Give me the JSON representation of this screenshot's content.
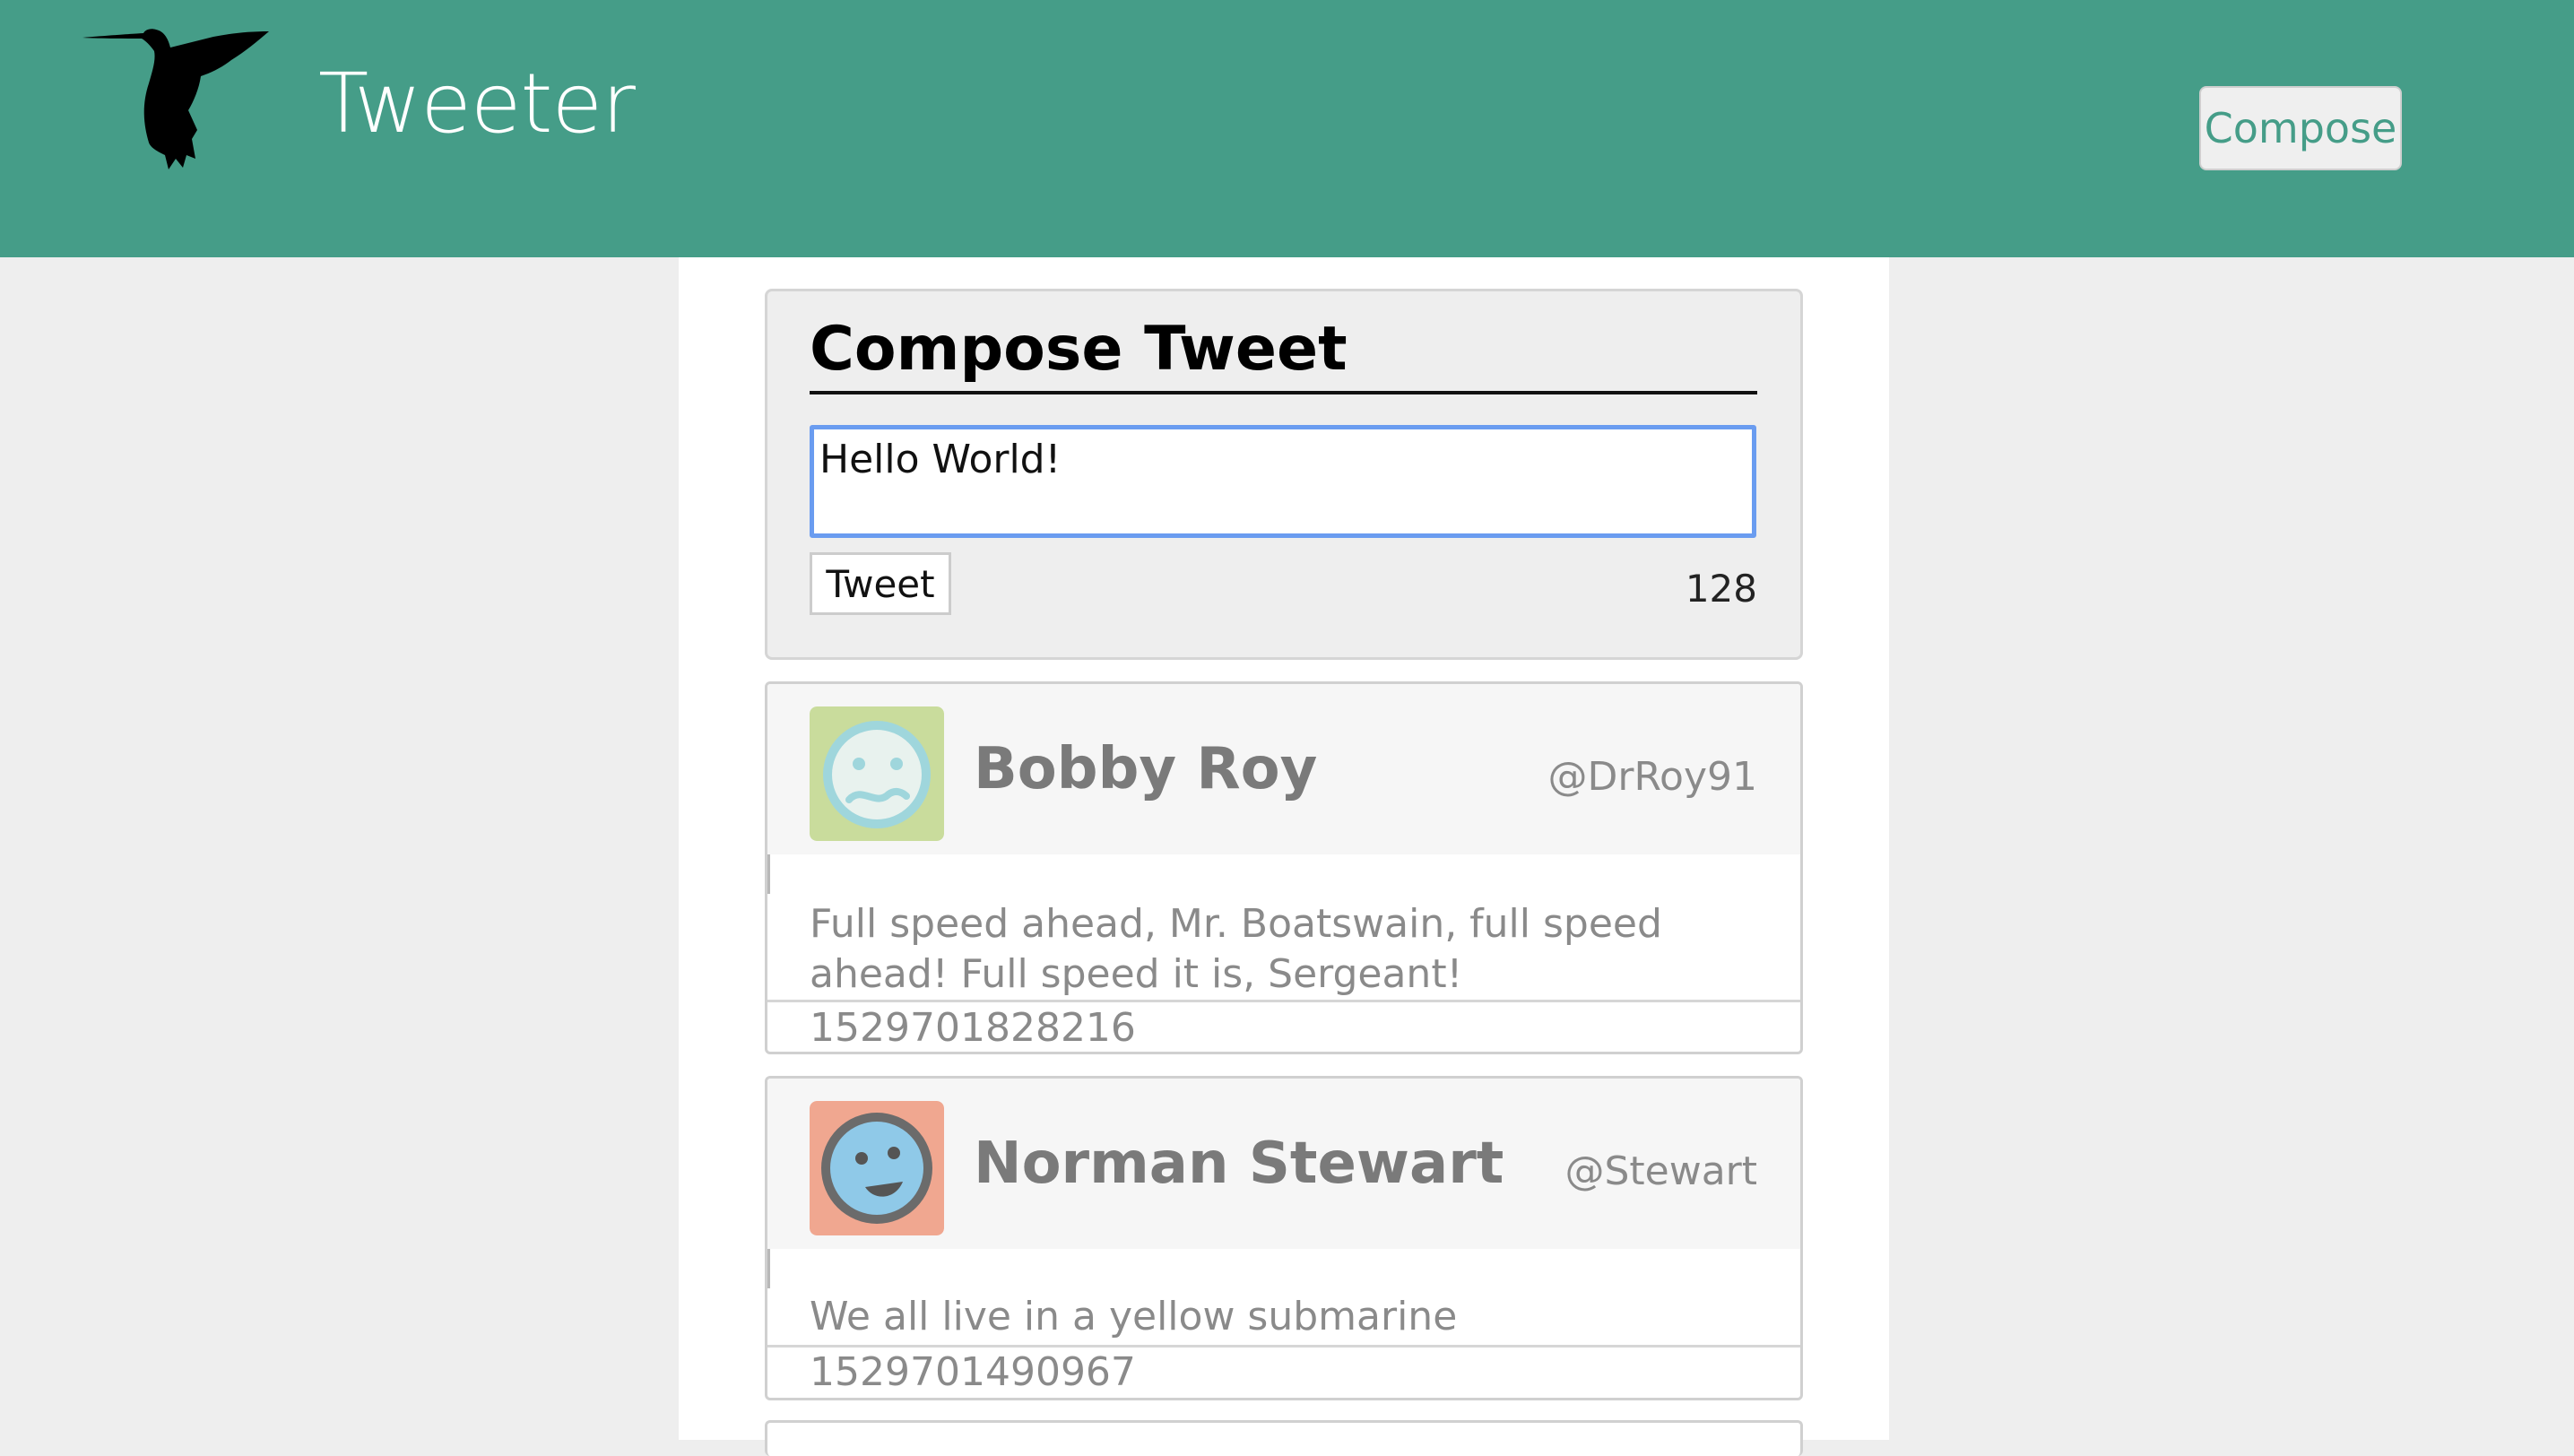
{
  "header": {
    "brand": "Tweeter",
    "logo_icon": "hummingbird-icon",
    "compose_label": "Compose",
    "bg_color": "#459d88"
  },
  "compose": {
    "title": "Compose Tweet",
    "text_value": "Hello World!",
    "tweet_button_label": "Tweet",
    "char_counter": "128"
  },
  "tweets": [
    {
      "name": "Bobby Roy",
      "handle": "@DrRoy91",
      "body": "Full speed ahead, Mr. Boatswain, full speed ahead! Full speed it is, Sergeant!",
      "timestamp": "1529701828216",
      "avatar_icon": "worried-face-avatar-icon",
      "avatar_color": "#c9dc9c"
    },
    {
      "name": "Norman Stewart",
      "handle": "@Stewart",
      "body": "We all live in a yellow submarine",
      "timestamp": "1529701490967",
      "avatar_icon": "smiling-face-avatar-icon",
      "avatar_color": "#f0a790"
    }
  ]
}
